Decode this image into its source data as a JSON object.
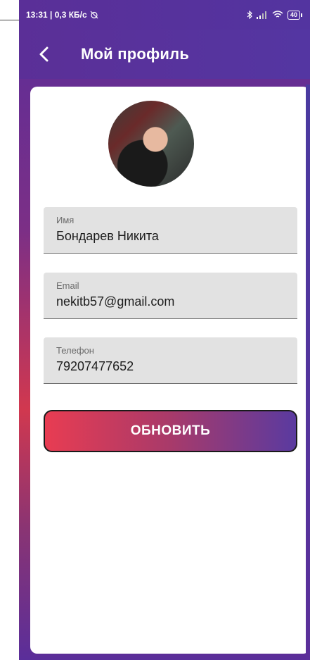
{
  "status_bar": {
    "time_and_speed": "13:31 | 0,3 КБ/с",
    "battery": "40"
  },
  "app_bar": {
    "title": "Мой профиль"
  },
  "profile": {
    "fields": [
      {
        "label": "Имя",
        "value": "Бондарев Никита"
      },
      {
        "label": "Email",
        "value": "nekitb57@gmail.com"
      },
      {
        "label": "Телефон",
        "value": "79207477652"
      }
    ]
  },
  "actions": {
    "update_label": "ОБНОВИТЬ"
  },
  "colors": {
    "accent_red": "#e83c52",
    "accent_purple": "#5a3aa0",
    "app_bar": "#5a3199"
  },
  "icons": [
    "back-arrow-icon",
    "alarm-off-icon",
    "bluetooth-icon",
    "signal-icon",
    "wifi-icon",
    "battery-icon"
  ]
}
